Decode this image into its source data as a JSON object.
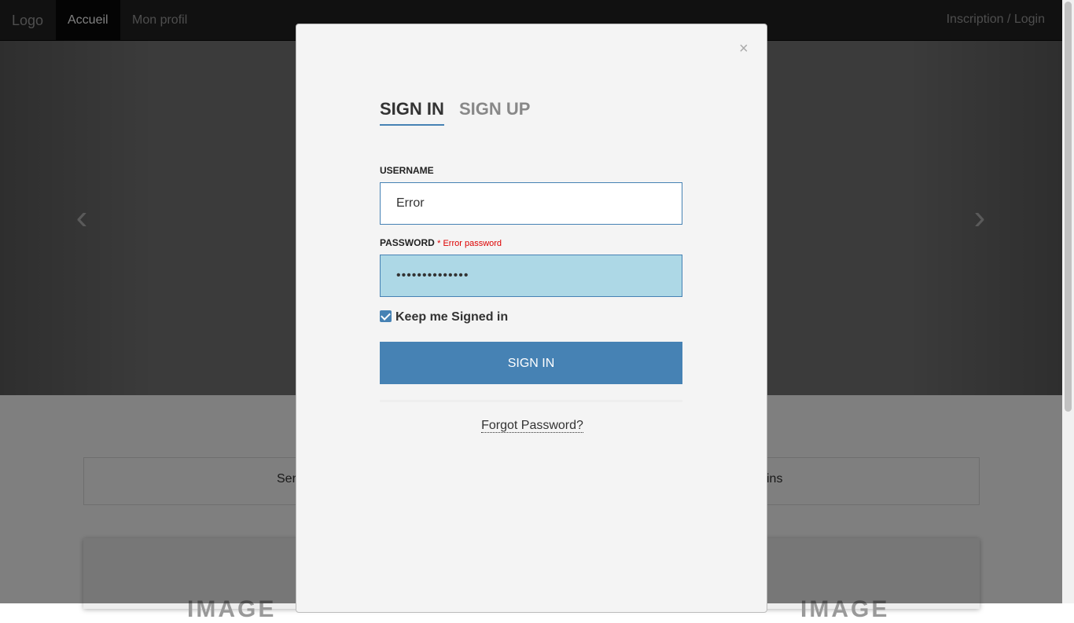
{
  "navbar": {
    "brand": "Logo",
    "items": [
      "Accueil",
      "Mon profil"
    ],
    "right": "Inscription / Login"
  },
  "carousel": {
    "prev_icon": "chevron-left-icon",
    "next_icon": "chevron-right-icon"
  },
  "services": {
    "left_fragment": "Ser",
    "right_fragment": "ins"
  },
  "images": {
    "left_label": "IMAGE",
    "right_label": "IMAGE"
  },
  "modal": {
    "close_symbol": "×",
    "tabs": [
      "SIGN IN",
      "SIGN UP"
    ],
    "username_label": "USERNAME",
    "username_value": "Error",
    "password_label": "PASSWORD",
    "password_error": "* Error password",
    "password_masked": "••••••••••••••",
    "keep_signed_label": "Keep me Signed in",
    "keep_signed_checked": true,
    "signin_button": "SIGN IN",
    "forgot_link": "Forgot Password?"
  },
  "colors": {
    "accent": "#4682b4",
    "error": "#dd0000",
    "password_bg": "#add8e6"
  }
}
